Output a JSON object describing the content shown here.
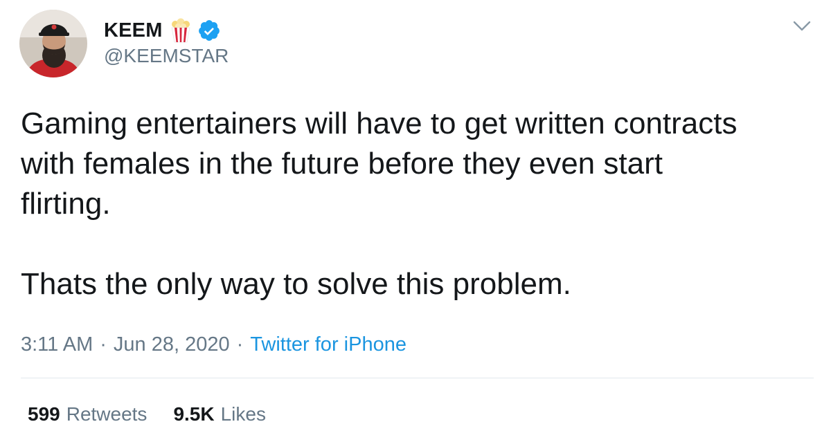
{
  "author": {
    "display_name": "KEEM",
    "handle": "@KEEMSTAR",
    "name_emoji_icon": "popcorn-icon",
    "verified_icon": "verified-badge-icon",
    "avatar_icon": "profile-photo"
  },
  "tweet": {
    "text": "Gaming entertainers will have to get written contracts\nwith females in the future before they even start\nflirting.\n\nThats the only way to solve this problem.",
    "time": "3:11 AM",
    "date": "Jun 28, 2020",
    "separator": "·",
    "source": "Twitter for iPhone"
  },
  "stats": {
    "retweets_count": "599",
    "retweets_label": "Retweets",
    "likes_count": "9.5K",
    "likes_label": "Likes"
  },
  "menu": {
    "icon": "chevron-down-icon"
  },
  "colors": {
    "text": "#14171a",
    "secondary": "#657786",
    "link": "#1b95e0",
    "verified": "#1da1f2",
    "divider": "#e1e8ed"
  }
}
